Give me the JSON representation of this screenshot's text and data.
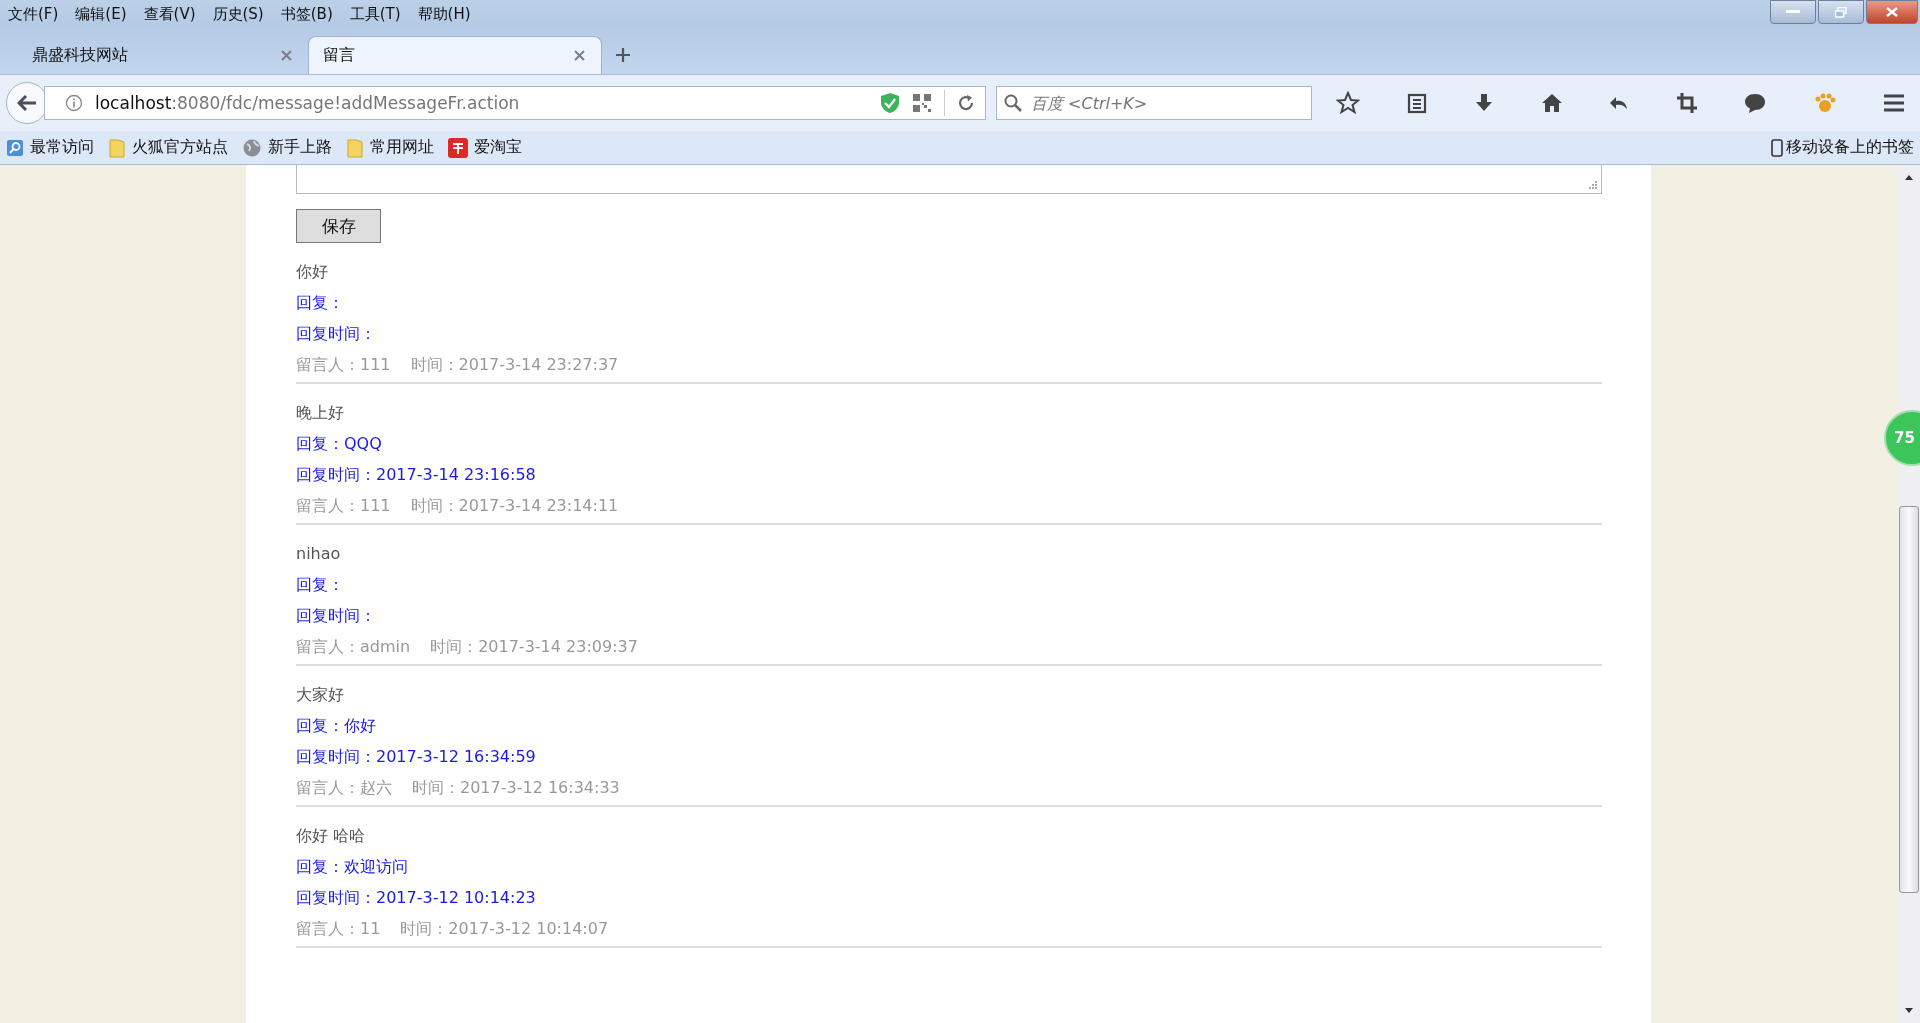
{
  "menu": [
    "文件(F)",
    "编辑(E)",
    "查看(V)",
    "历史(S)",
    "书签(B)",
    "工具(T)",
    "帮助(H)"
  ],
  "tabs": [
    {
      "title": "鼎盛科技网站",
      "selected": false
    },
    {
      "title": "留言",
      "selected": true
    }
  ],
  "address": {
    "host": "localhost",
    "rest": ":8080/fdc/message!addMessageFr.action"
  },
  "search": {
    "placeholder": "百度 <Ctrl+K>"
  },
  "bookmarks": [
    {
      "label": "最常访问",
      "kind": "visits"
    },
    {
      "label": "火狐官方站点",
      "kind": "folder"
    },
    {
      "label": "新手上路",
      "kind": "globe"
    },
    {
      "label": "常用网址",
      "kind": "folder"
    },
    {
      "label": "爱淘宝",
      "kind": "taobao"
    }
  ],
  "mobile_bookmarks": "移动设备上的书签",
  "save_button": "保存",
  "messages": [
    {
      "content": "你好",
      "reply": "回复：",
      "reply_time": "回复时间：",
      "author": "留言人：111",
      "time": "时间：2017-3-14 23:27:37"
    },
    {
      "content": "晚上好",
      "reply": "回复：QQQ",
      "reply_time": "回复时间：2017-3-14 23:16:58",
      "author": "留言人：111",
      "time": "时间：2017-3-14 23:14:11"
    },
    {
      "content": "nihao",
      "reply": "回复：",
      "reply_time": "回复时间：",
      "author": "留言人：admin",
      "time": "时间：2017-3-14 23:09:37"
    },
    {
      "content": "大家好",
      "reply": "回复：你好",
      "reply_time": "回复时间：2017-3-12 16:34:59",
      "author": "留言人：赵六",
      "time": "时间：2017-3-12 16:34:33"
    },
    {
      "content": "你好 哈哈",
      "reply": "回复：欢迎访问",
      "reply_time": "回复时间：2017-3-12 10:14:23",
      "author": "留言人：11",
      "time": "时间：2017-3-12 10:14:07"
    }
  ],
  "floating_badge": "75"
}
